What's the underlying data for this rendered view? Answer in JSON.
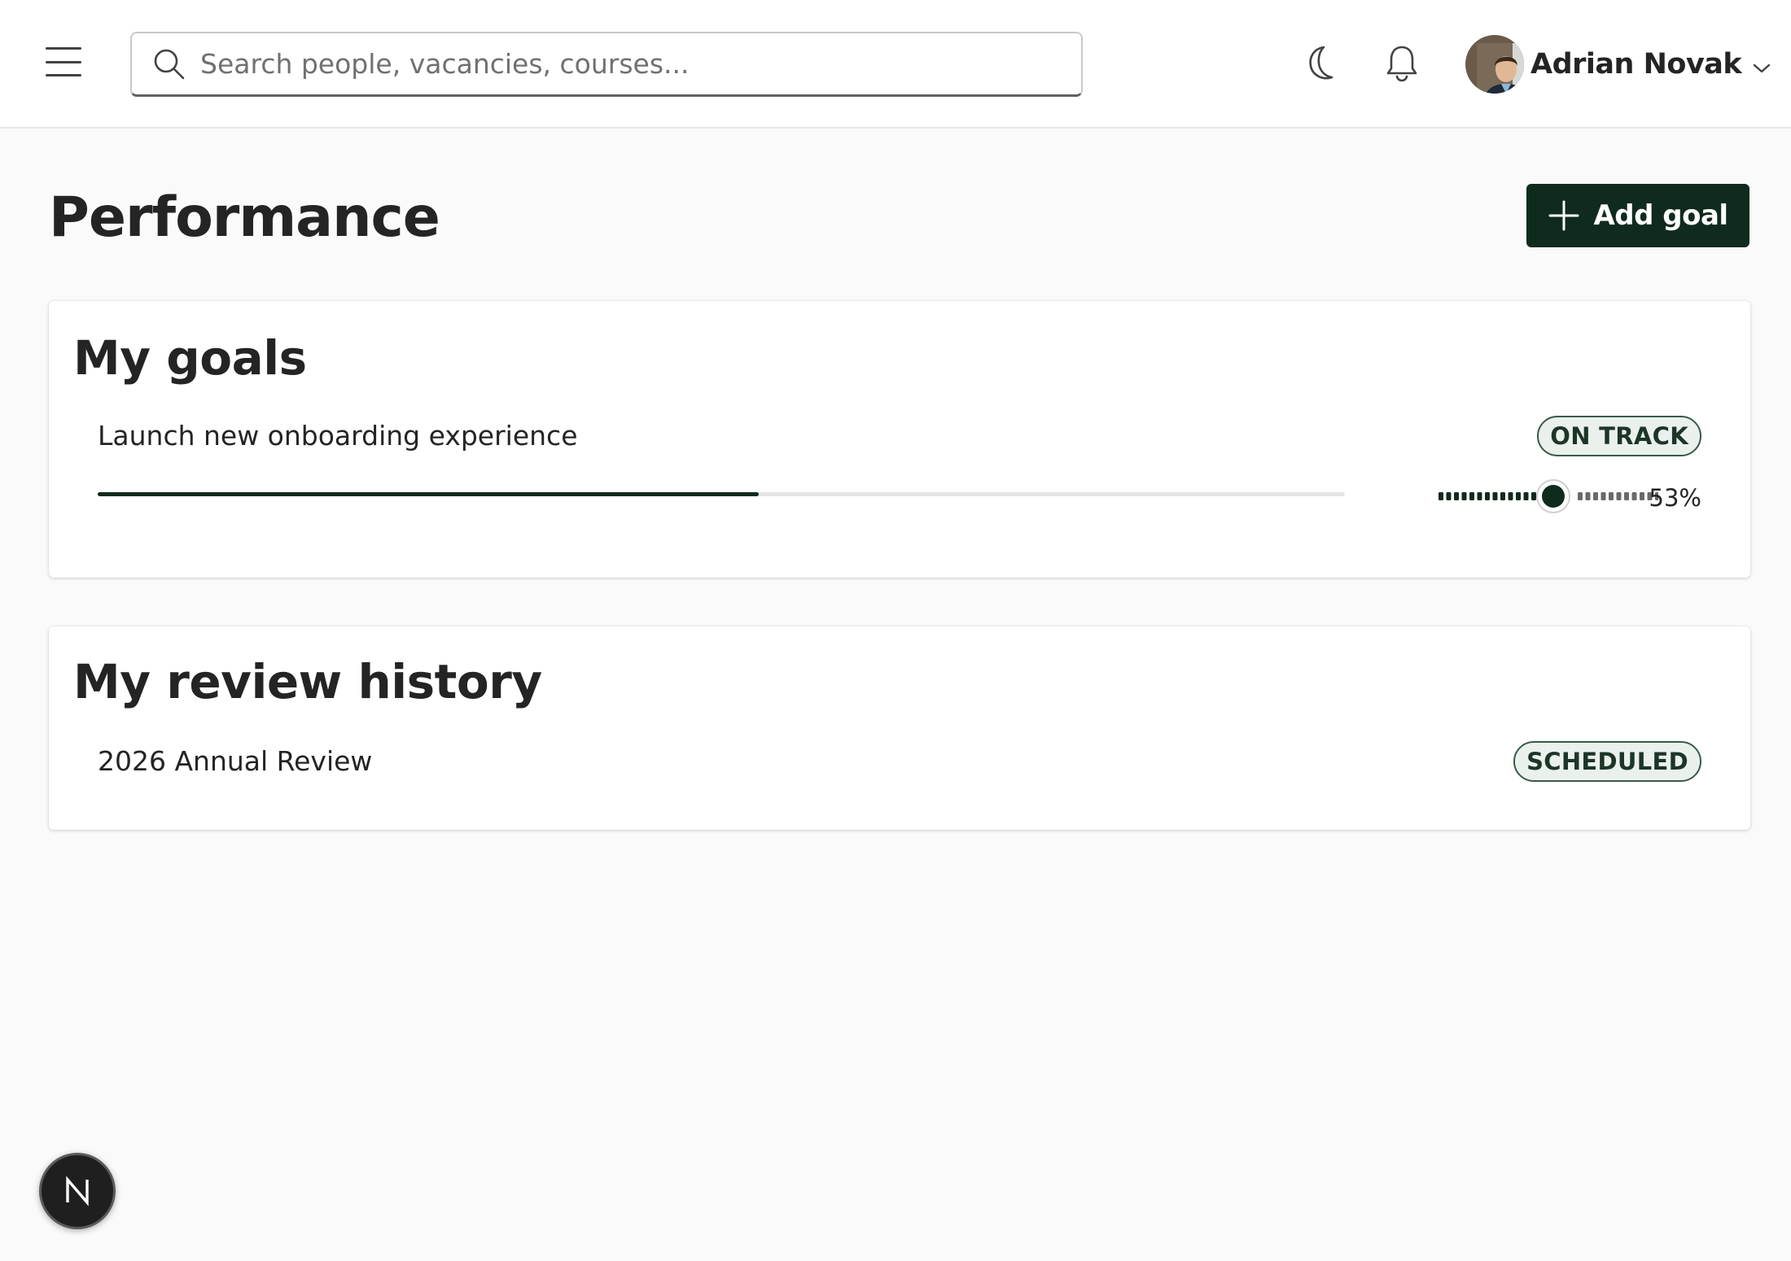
{
  "header": {
    "menu_icon": "hamburger-icon",
    "search": {
      "placeholder": "Search people, vacancies, courses...",
      "value": ""
    },
    "theme_icon": "moon-icon",
    "notifications_icon": "bell-icon",
    "user": {
      "name": "Adrian Novak",
      "dropdown_icon": "chevron-down-icon"
    }
  },
  "page": {
    "title": "Performance",
    "add_goal_label": "Add goal",
    "add_goal_icon": "plus-icon"
  },
  "goals": {
    "title": "My goals",
    "items": [
      {
        "name": "Launch new onboarding experience",
        "status": "ON TRACK",
        "progress": 0.53,
        "progress_label": "53%"
      }
    ]
  },
  "reviews": {
    "title": "My review history",
    "items": [
      {
        "name": "2026 Annual Review",
        "status": "SCHEDULED"
      }
    ]
  },
  "fab": {
    "label": "N"
  },
  "colors": {
    "accent": "#0f2b1e",
    "badge_bg": "#eaf1ec",
    "badge_border": "#3a5a48"
  }
}
